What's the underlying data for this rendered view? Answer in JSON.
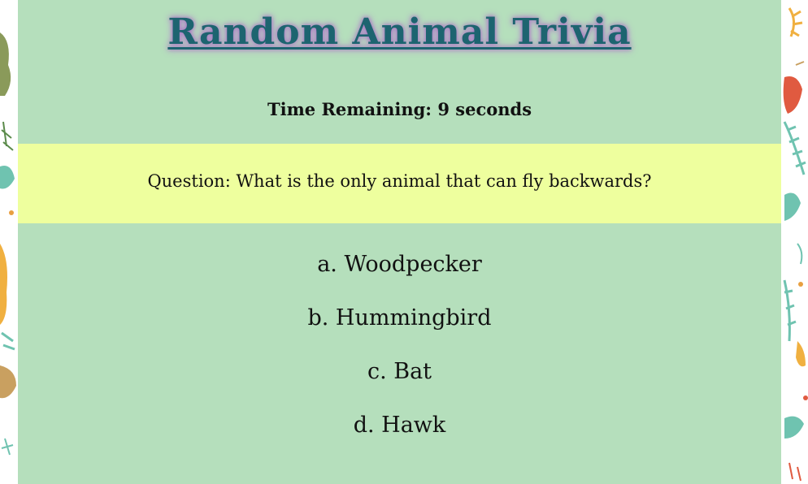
{
  "title": "Random Animal Trivia",
  "timer": {
    "text": "Time Remaining: 9 seconds"
  },
  "question": {
    "text": "Question: What is the only animal that can fly backwards?"
  },
  "answers": [
    {
      "label": "a. Woodpecker"
    },
    {
      "label": "b. Hummingbird"
    },
    {
      "label": "c. Bat"
    },
    {
      "label": "d. Hawk"
    }
  ],
  "colors": {
    "panel": "#b5dfbc",
    "question_band": "#eeff9e",
    "title": "#1d6470",
    "title_glow": "#a56bc0"
  },
  "decor": {
    "pattern": "animal-and-leaf-silhouettes"
  }
}
